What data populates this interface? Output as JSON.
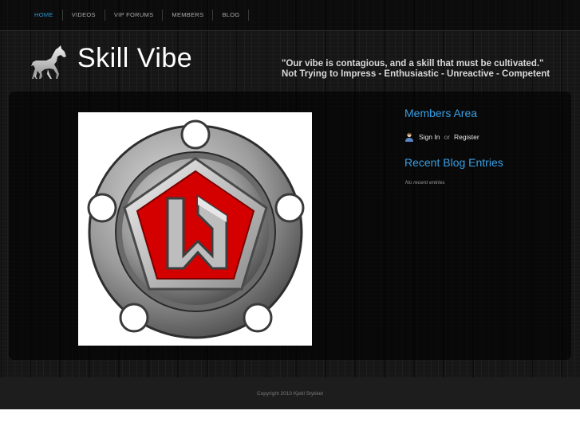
{
  "nav": {
    "items": [
      {
        "label": "HOME",
        "active": true
      },
      {
        "label": "VIDEOS",
        "active": false
      },
      {
        "label": "VIP FORUMS",
        "active": false
      },
      {
        "label": "MEMBERS",
        "active": false
      },
      {
        "label": "BLOG",
        "active": false
      }
    ]
  },
  "header": {
    "site_title": "Skill Vibe",
    "tagline_line1": "\"Our vibe is contagious, and a skill that must be cultivated.\"",
    "tagline_line2": "Not Trying to Impress - Enthusiastic - Unreactive - Competent",
    "logo_icon": "horse-icon"
  },
  "main": {
    "feature_image_icon": "rune-emblem"
  },
  "sidebar": {
    "members_heading": "Members Area",
    "signin_label": "Sign In",
    "or_label": "or",
    "register_label": "Register",
    "user_icon": "user-icon",
    "blog_heading": "Recent Blog Entries",
    "no_entries": "No recent entries"
  },
  "footer": {
    "copyright": "Copyright 2010 Kjetil Stykket"
  },
  "colors": {
    "accent": "#3a9fe3",
    "nav_active": "#2d96d6",
    "emblem_red": "#d40000"
  }
}
